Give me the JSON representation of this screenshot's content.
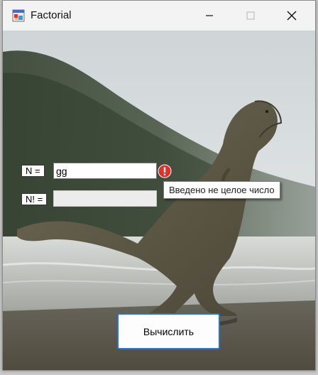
{
  "window": {
    "title": "Factorial",
    "icon": "app-icon",
    "controls": [
      "minimize-icon",
      "maximize-icon",
      "close-icon"
    ]
  },
  "form": {
    "n_label": "N =",
    "n_value": "gg",
    "factorial_label": "N! =",
    "factorial_value": "",
    "error_icon": "exclamation-icon",
    "error_tooltip": "Введено не целое число",
    "calculate_button": "Вычислить"
  },
  "colors": {
    "error": "#e0302a",
    "button_border": "#2b73c9"
  }
}
